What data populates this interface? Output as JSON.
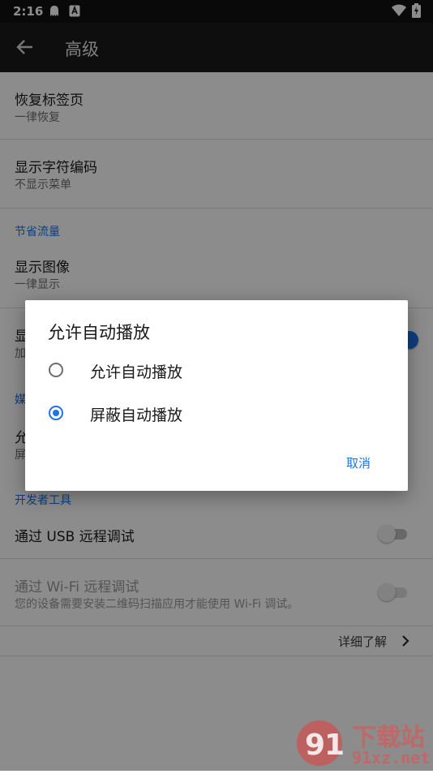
{
  "status_bar": {
    "time": "2:16"
  },
  "app_bar": {
    "title": "高级"
  },
  "settings": [
    {
      "title": "恢复标签页",
      "subtitle": "一律恢复"
    },
    {
      "title": "显示字符编码",
      "subtitle": "不显示菜单"
    },
    {
      "section": "节省流量"
    },
    {
      "title": "显示图像",
      "subtitle": "一律显示"
    },
    {
      "title_partial": "显",
      "subtitle_partial": "加"
    },
    {
      "section_partial": "媒"
    },
    {
      "title_partial": "允",
      "subtitle_partial": "屏"
    },
    {
      "section": "开发者工具"
    },
    {
      "title": "通过 USB 远程调试"
    },
    {
      "title": "通过 Wi-Fi 远程调试",
      "subtitle": "您的设备需要安装二维码扫描应用才能使用 Wi-Fi 调试。"
    }
  ],
  "learn_more": "详细了解",
  "dialog": {
    "title": "允许自动播放",
    "options": [
      {
        "label": "允许自动播放",
        "checked": false
      },
      {
        "label": "屏蔽自动播放",
        "checked": true
      }
    ],
    "cancel": "取消"
  },
  "watermark": {
    "text": "下载站",
    "url": "91xz.net"
  },
  "colors": {
    "accent": "#1a73e8",
    "appbar": "#1b1b1b"
  }
}
